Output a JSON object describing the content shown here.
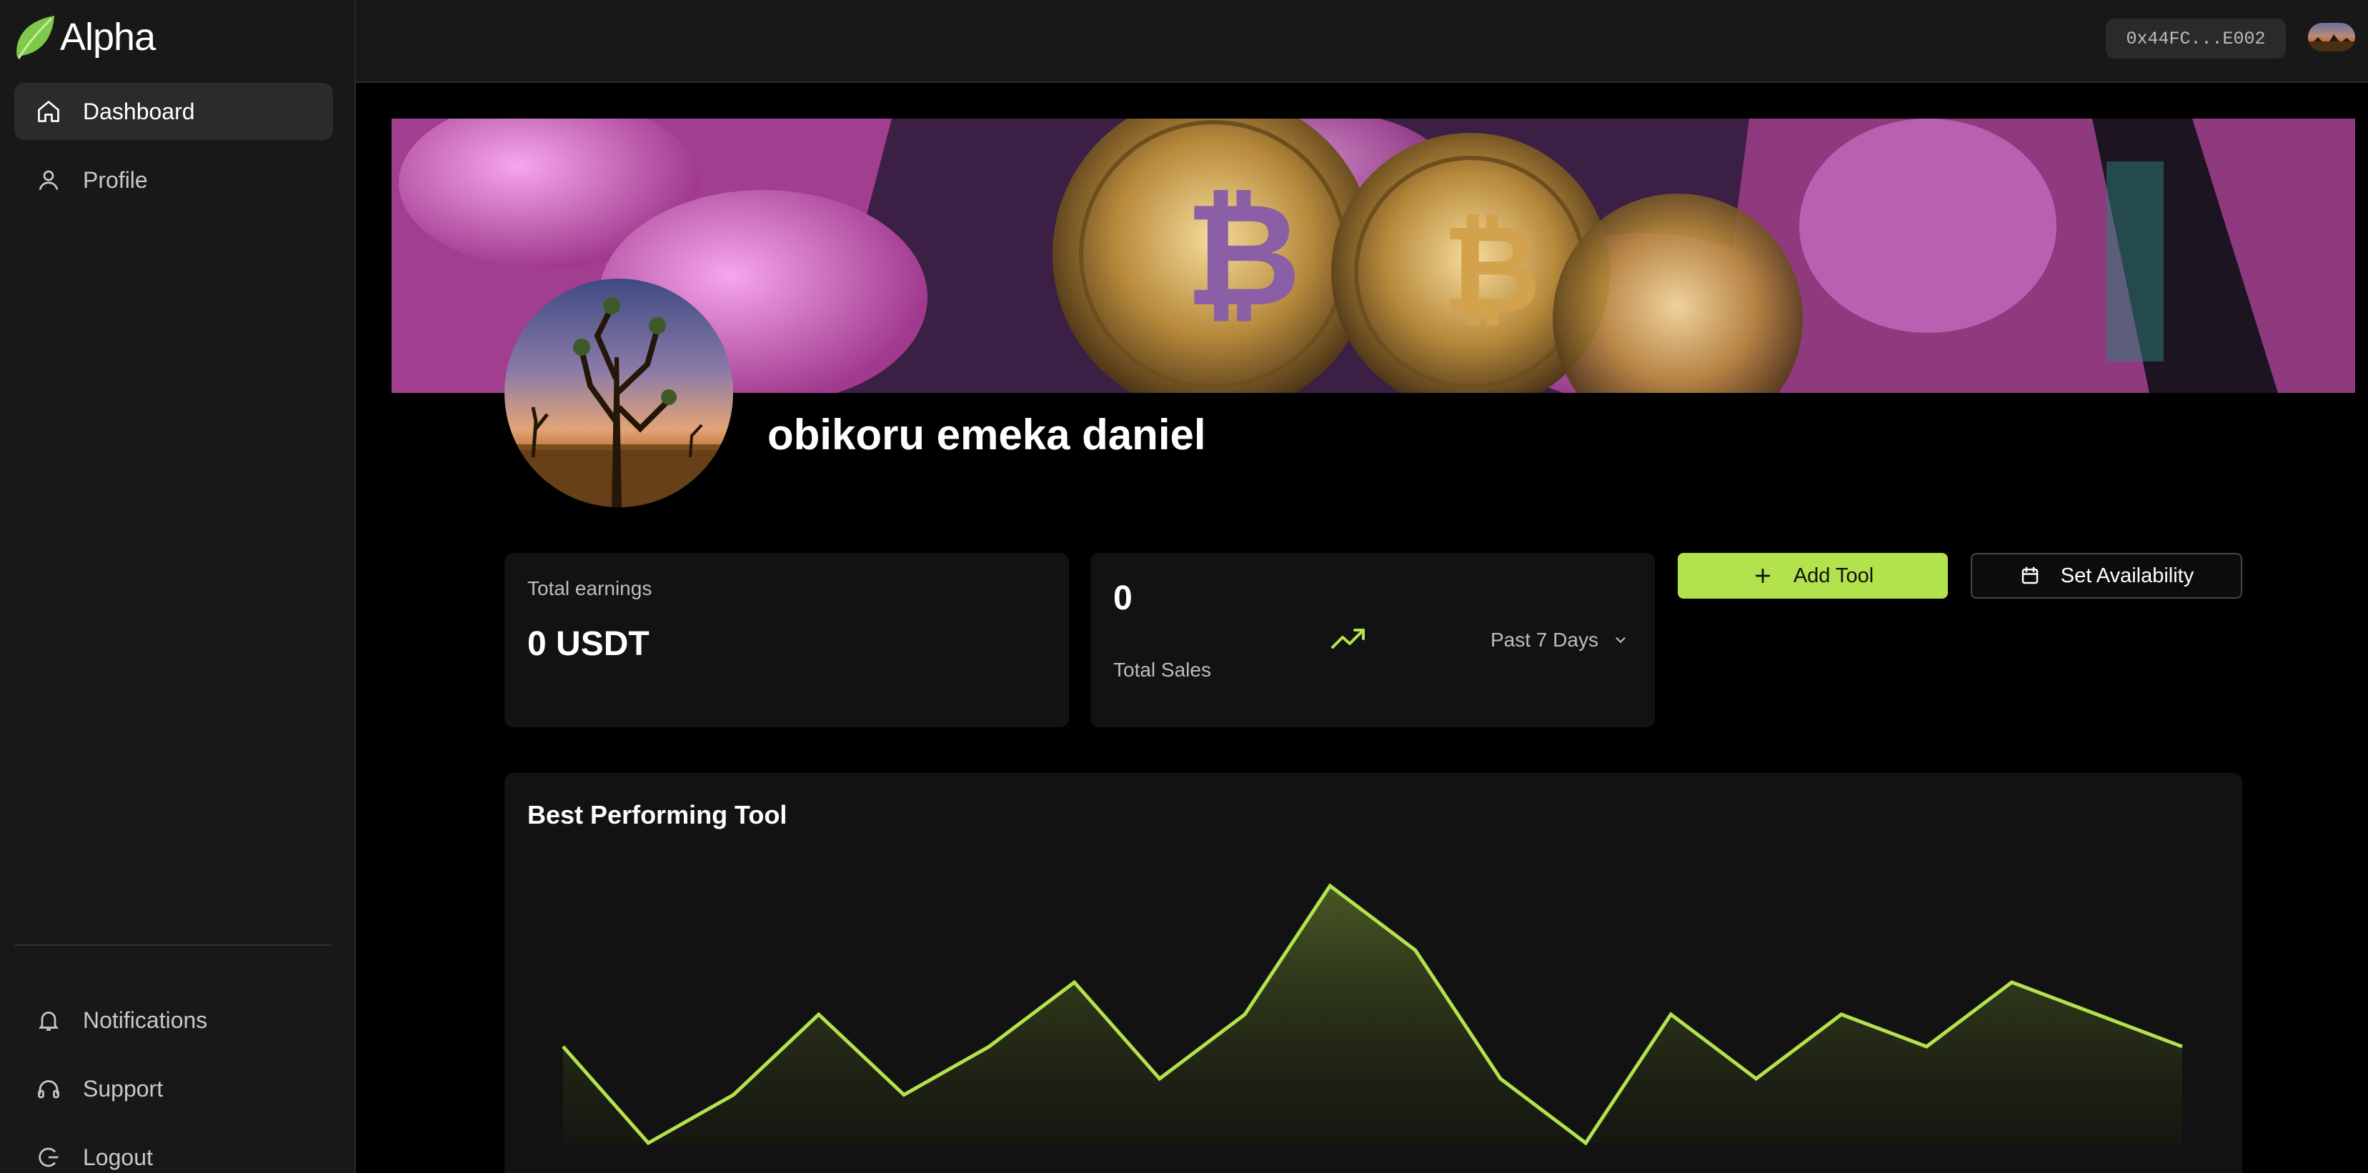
{
  "app": {
    "name": "Alpha"
  },
  "sidebar": {
    "nav": [
      {
        "label": "Dashboard",
        "icon": "home-icon",
        "active": true
      },
      {
        "label": "Profile",
        "icon": "user-icon",
        "active": false
      }
    ],
    "footer": [
      {
        "label": "Notifications",
        "icon": "bell-icon"
      },
      {
        "label": "Support",
        "icon": "headphones-icon"
      },
      {
        "label": "Logout",
        "icon": "logout-icon"
      }
    ]
  },
  "header": {
    "wallet_address": "0x44FC...E002"
  },
  "profile": {
    "name": "obikoru emeka daniel"
  },
  "stats": {
    "earnings_label": "Total earnings",
    "earnings_value": "0 USDT",
    "sales_value": "0",
    "sales_label": "Total Sales",
    "period": "Past 7 Days"
  },
  "actions": {
    "add_tool": "Add Tool",
    "set_availability": "Set Availability"
  },
  "colors": {
    "accent": "#b2e24c",
    "background": "#000000",
    "sidebar": "#181818",
    "card": "#121212"
  },
  "chart_data": {
    "type": "area",
    "title": "Best Performing Tool",
    "values": [
      3,
      0,
      1.5,
      4,
      1.5,
      3,
      5,
      2,
      4,
      8,
      6,
      2,
      0,
      4,
      2,
      4,
      3,
      5,
      4,
      3
    ],
    "ylim": [
      0,
      8
    ],
    "grid": false,
    "color": "#b2e24c"
  }
}
